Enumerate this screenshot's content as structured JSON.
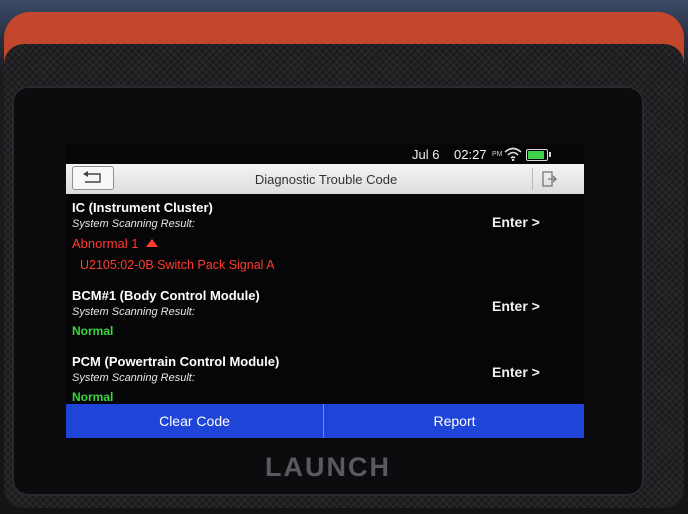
{
  "status_bar": {
    "date": "Jul 6",
    "time": "02:27",
    "ampm": "PM"
  },
  "header": {
    "title": "Diagnostic Trouble Code"
  },
  "modules": [
    {
      "name": "IC (Instrument Cluster)",
      "scan_label": "System Scanning Result:",
      "status": "Abnormal 1",
      "status_type": "abnormal",
      "dtc": "U2105:02-0B Switch Pack Signal A",
      "enter_label": "Enter >"
    },
    {
      "name": "BCM#1 (Body Control Module)",
      "scan_label": "System Scanning Result:",
      "status": "Normal",
      "status_type": "normal",
      "enter_label": "Enter >"
    },
    {
      "name": "PCM (Powertrain Control Module)",
      "scan_label": "System Scanning Result:",
      "status": "Normal",
      "status_type": "normal",
      "enter_label": "Enter >"
    }
  ],
  "footer": {
    "clear_code_label": "Clear Code",
    "report_label": "Report"
  },
  "device": {
    "brand": "LAUNCH"
  },
  "colors": {
    "accent_blue": "#1f44d8",
    "normal_green": "#39d63c",
    "abnormal_red": "#ff3b30",
    "bumper_orange": "#b0381f"
  },
  "icons": {
    "back": "back-arrow-icon",
    "exit": "exit-icon",
    "wifi": "wifi-icon",
    "battery": "battery-icon",
    "expand": "caret-up-icon"
  }
}
